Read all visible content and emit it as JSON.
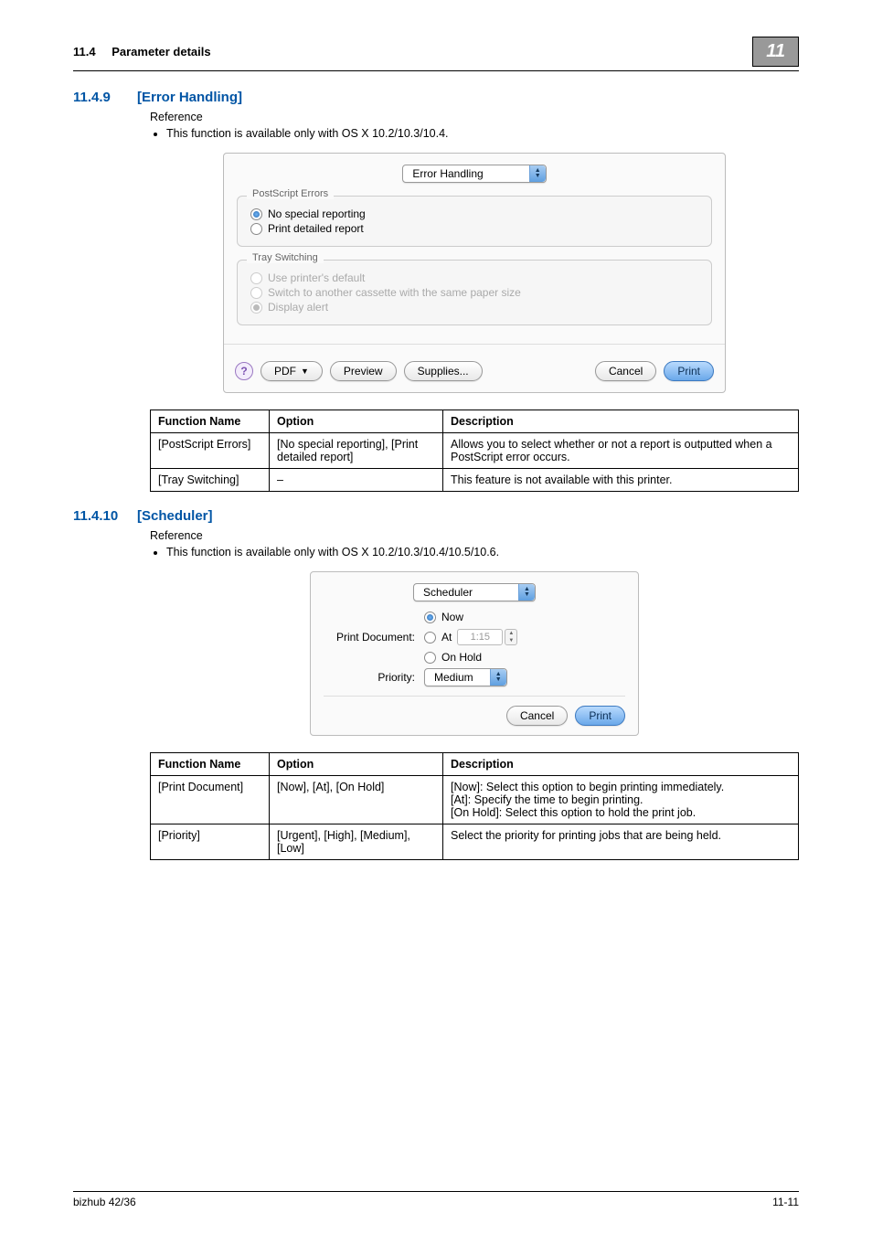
{
  "header": {
    "section_number": "11.4",
    "section_title": "Parameter details",
    "chapter": "11"
  },
  "s1": {
    "num": "11.4.9",
    "title": "[Error Handling]",
    "reference_label": "Reference",
    "bullet": "This function is available only with OS X 10.2/10.3/10.4.",
    "panel": {
      "selector": "Error Handling",
      "group1_label": "PostScript Errors",
      "opt1a": "No special reporting",
      "opt1b": "Print detailed report",
      "group2_label": "Tray Switching",
      "opt2a": "Use printer's default",
      "opt2b": "Switch to another cassette with the same paper size",
      "opt2c": "Display alert",
      "pdf_btn": "PDF",
      "preview_btn": "Preview",
      "supplies_btn": "Supplies...",
      "cancel_btn": "Cancel",
      "print_btn": "Print"
    },
    "table": {
      "h1": "Function Name",
      "h2": "Option",
      "h3": "Description",
      "r1c1": "[PostScript Errors]",
      "r1c2": "[No special reporting], [Print detailed report]",
      "r1c3": "Allows you to select whether or not a report is outputted when a PostScript error occurs.",
      "r2c1": "[Tray Switching]",
      "r2c2": "–",
      "r2c3": "This feature is not available with this printer."
    }
  },
  "s2": {
    "num": "11.4.10",
    "title": "[Scheduler]",
    "reference_label": "Reference",
    "bullet": "This function is available only with OS X 10.2/10.3/10.4/10.5/10.6.",
    "panel": {
      "selector": "Scheduler",
      "print_doc_label": "Print Document:",
      "now": "Now",
      "at": "At",
      "at_time": "1:15",
      "on_hold": "On Hold",
      "priority_label": "Priority:",
      "priority_value": "Medium",
      "cancel_btn": "Cancel",
      "print_btn": "Print"
    },
    "table": {
      "h1": "Function Name",
      "h2": "Option",
      "h3": "Description",
      "r1c1": "[Print Document]",
      "r1c2": "[Now], [At], [On Hold]",
      "r1c3": "[Now]: Select this option to begin printing immediately.\n[At]: Specify the time to begin printing.\n[On Hold]: Select this option to hold the print job.",
      "r2c1": "[Priority]",
      "r2c2": "[Urgent], [High], [Medium], [Low]",
      "r2c3": "Select the priority for printing jobs that are being held."
    }
  },
  "footer": {
    "left": "bizhub 42/36",
    "right": "11-11"
  }
}
